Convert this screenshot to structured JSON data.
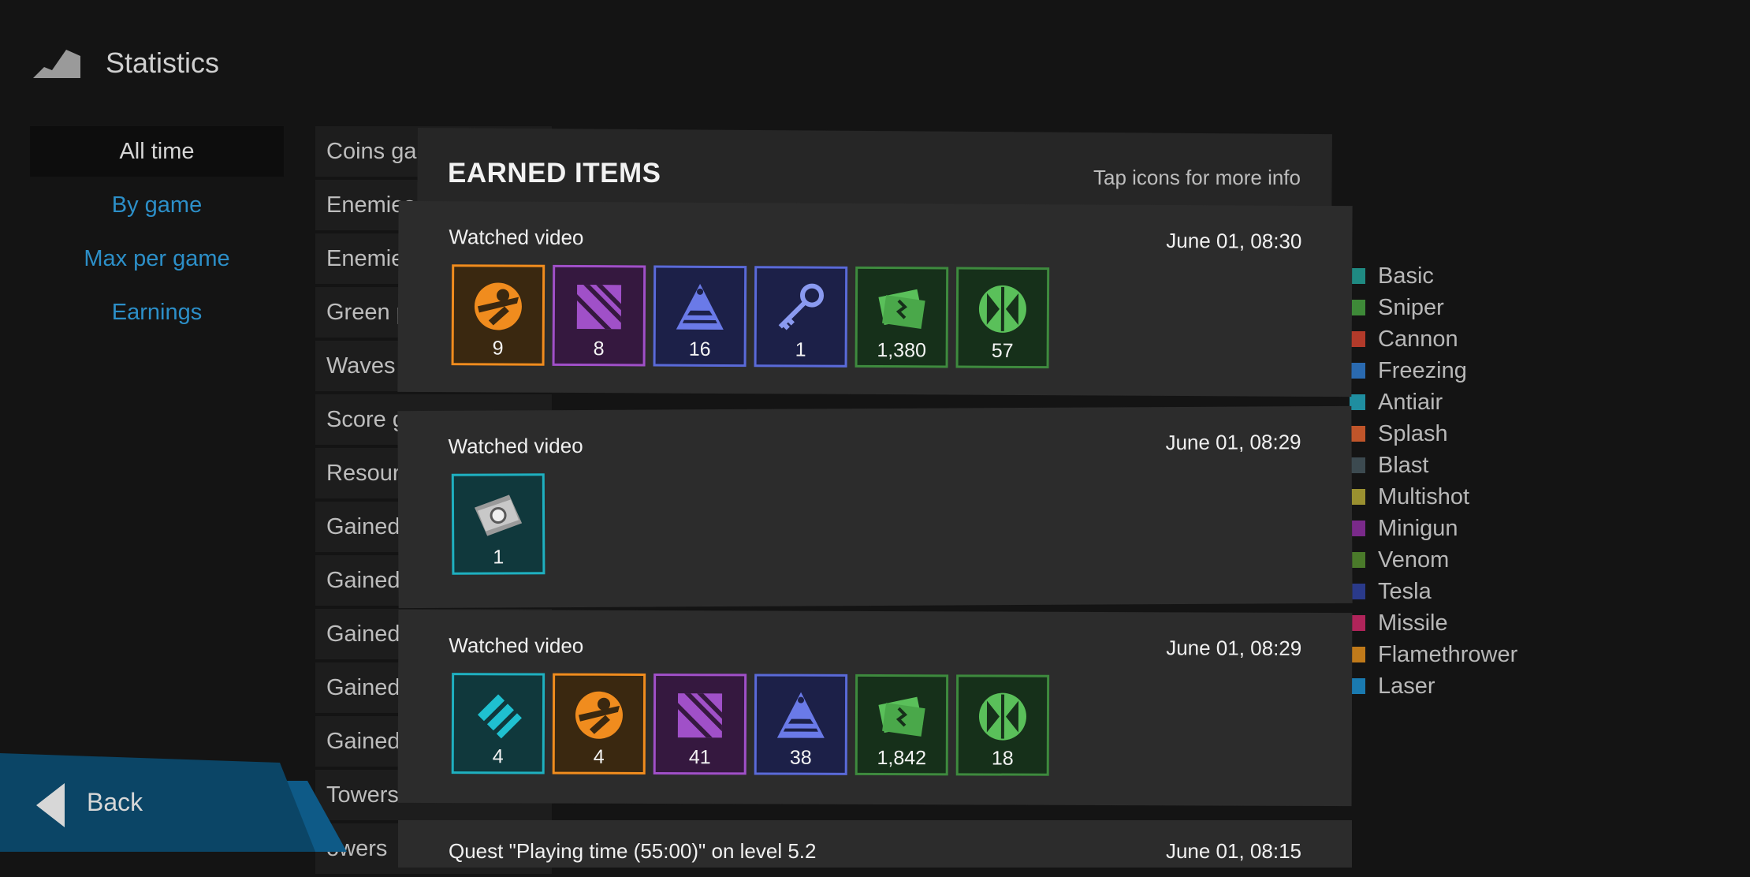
{
  "header": {
    "title": "Statistics",
    "icon": "mountain-icon"
  },
  "menu": [
    {
      "label": "All time",
      "active": true
    },
    {
      "label": "By game"
    },
    {
      "label": "Max per game"
    },
    {
      "label": "Earnings"
    }
  ],
  "stats_rows": [
    "Coins gai",
    "Enemies",
    "Enemie",
    "Green p",
    "Waves c",
    "Score g",
    "Resour",
    "Gained",
    "Gained",
    "Gained",
    "Gained",
    "Gained",
    "Towers b",
    "owers"
  ],
  "legend": [
    {
      "label": "Basic",
      "color": "#1f8a82"
    },
    {
      "label": "Sniper",
      "color": "#3e8a38"
    },
    {
      "label": "Cannon",
      "color": "#b23a2a"
    },
    {
      "label": "Freezing",
      "color": "#2a6ab0"
    },
    {
      "label": "Antiair",
      "color": "#1f8ea0"
    },
    {
      "label": "Splash",
      "color": "#c0552a"
    },
    {
      "label": "Blast",
      "color": "#3c4a50"
    },
    {
      "label": "Multishot",
      "color": "#9a9030"
    },
    {
      "label": "Minigun",
      "color": "#7a2a8a"
    },
    {
      "label": "Venom",
      "color": "#4a7a2a"
    },
    {
      "label": "Tesla",
      "color": "#2a3a8a"
    },
    {
      "label": "Missile",
      "color": "#b0245a"
    },
    {
      "label": "Flamethrower",
      "color": "#c07a1a"
    },
    {
      "label": "Laser",
      "color": "#1a7ab0"
    }
  ],
  "back": {
    "label": "Back"
  },
  "modal": {
    "title": "EARNED ITEMS",
    "hint": "Tap icons for more info",
    "entries": [
      {
        "title": "Watched video",
        "time": "June 01, 08:30",
        "items": [
          {
            "icon": "orange-ability-icon",
            "count": "9",
            "border": "#f08c1e",
            "bg": "#3a2810"
          },
          {
            "icon": "purple-stripes-icon",
            "count": "8",
            "border": "#a050c8",
            "bg": "#35183f"
          },
          {
            "icon": "blue-pyramid-icon",
            "count": "16",
            "border": "#5a6ad8",
            "bg": "#1c2048"
          },
          {
            "icon": "key-icon",
            "count": "1",
            "border": "#5a6ad8",
            "bg": "#1c2048"
          },
          {
            "icon": "green-money-icon",
            "count": "1,380",
            "border": "#3e8a3e",
            "bg": "#16301a"
          },
          {
            "icon": "green-research-icon",
            "count": "57",
            "border": "#3e8a3e",
            "bg": "#16301a"
          }
        ]
      },
      {
        "title": "Watched video",
        "time": "June 01, 08:29",
        "items": [
          {
            "icon": "ticket-icon",
            "count": "1",
            "border": "#1fb0c0",
            "bg": "#10383c"
          }
        ]
      },
      {
        "title": "Watched video",
        "time": "June 01, 08:29",
        "items": [
          {
            "icon": "cyan-lightning-icon",
            "count": "4",
            "border": "#1fb0c0",
            "bg": "#10383c"
          },
          {
            "icon": "orange-ability-icon",
            "count": "4",
            "border": "#f08c1e",
            "bg": "#3a2810"
          },
          {
            "icon": "purple-stripes-icon",
            "count": "41",
            "border": "#a050c8",
            "bg": "#35183f"
          },
          {
            "icon": "blue-pyramid-icon",
            "count": "38",
            "border": "#5a6ad8",
            "bg": "#1c2048"
          },
          {
            "icon": "green-money-icon",
            "count": "1,842",
            "border": "#3e8a3e",
            "bg": "#16301a"
          },
          {
            "icon": "green-research-icon",
            "count": "18",
            "border": "#3e8a3e",
            "bg": "#16301a"
          }
        ]
      },
      {
        "title": "Quest \"Playing time (55:00)\" on level 5.2",
        "time": "June 01, 08:15",
        "items": []
      }
    ]
  }
}
